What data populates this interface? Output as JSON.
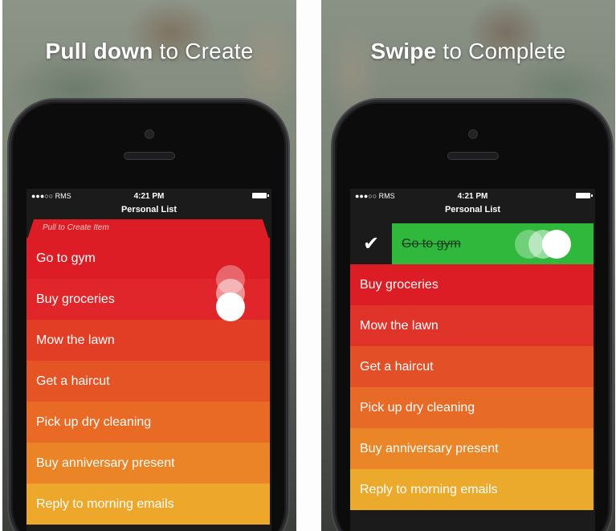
{
  "left_panel": {
    "caption_bold": "Pull down",
    "caption_rest": " to Create",
    "status": {
      "carrier": "●●●○○ RMS",
      "time": "4:21 PM"
    },
    "list_title": "Personal List",
    "pull_hint": "Pull to Create Item",
    "items": [
      {
        "label": "Go to gym",
        "color": "#dd1d25"
      },
      {
        "label": "Buy groceries",
        "color": "#e0262a"
      },
      {
        "label": "Mow the lawn",
        "color": "#e23e25"
      },
      {
        "label": "Get a haircut",
        "color": "#e45425"
      },
      {
        "label": "Pick up dry cleaning",
        "color": "#e86a25"
      },
      {
        "label": "Buy anniversary present",
        "color": "#eb8427"
      },
      {
        "label": "Reply to morning emails",
        "color": "#eda72b"
      }
    ]
  },
  "right_panel": {
    "caption_bold": "Swipe",
    "caption_rest": " to Complete",
    "status": {
      "carrier": "●●●○○ RMS",
      "time": "4:21 PM"
    },
    "list_title": "Personal List",
    "completed_item": {
      "label": "Go to gym",
      "check": "✔",
      "color": "#2fb83b"
    },
    "items": [
      {
        "label": "Buy groceries",
        "color": "#dd1d25"
      },
      {
        "label": "Mow the lawn",
        "color": "#e0342a"
      },
      {
        "label": "Get a haircut",
        "color": "#e34f26"
      },
      {
        "label": "Pick up dry cleaning",
        "color": "#e76a26"
      },
      {
        "label": "Buy anniversary present",
        "color": "#ea8627"
      },
      {
        "label": "Reply to morning emails",
        "color": "#ecaa2c"
      }
    ]
  }
}
